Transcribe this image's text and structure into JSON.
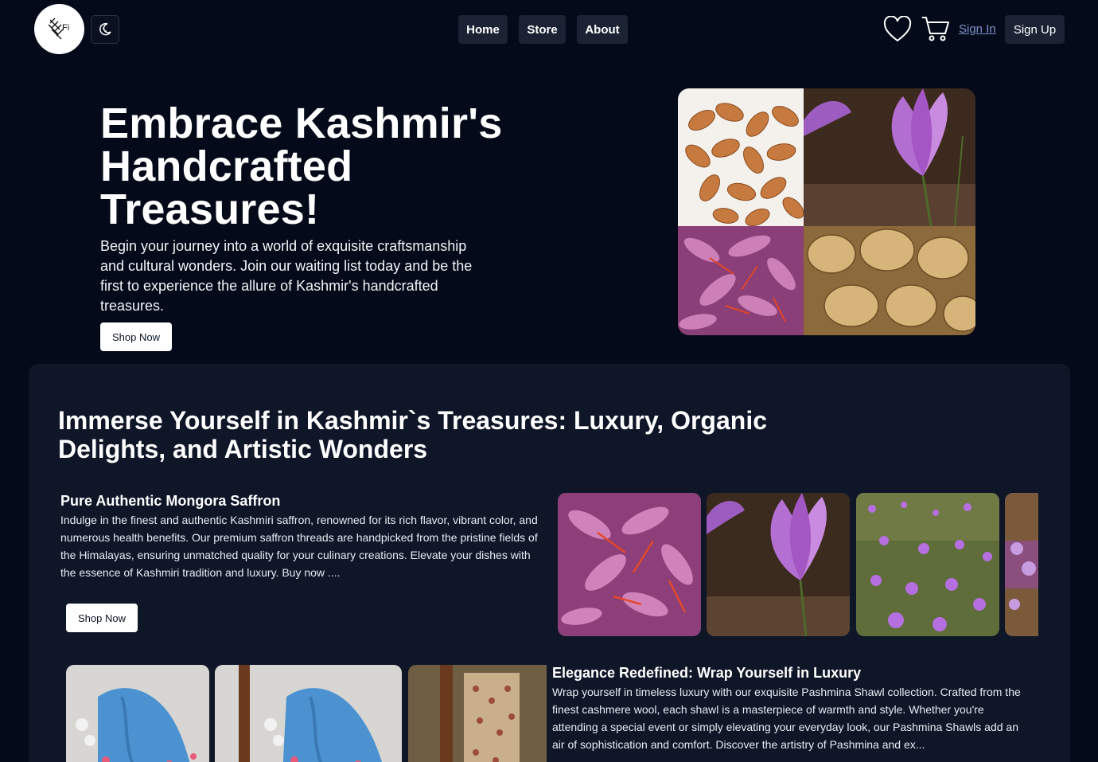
{
  "header": {
    "logo_text": "Fi",
    "nav": [
      "Home",
      "Store",
      "About"
    ],
    "signin": "Sign In",
    "signup": "Sign Up"
  },
  "hero": {
    "title": "Embrace Kashmir's Handcrafted Treasures!",
    "description": "Begin your journey into a world of exquisite craftsmanship and cultural wonders. Join our waiting list today and be the first to experience the allure of Kashmir's handcrafted treasures.",
    "cta": "Shop Now"
  },
  "section": {
    "title": "Immerse Yourself in Kashmir`s Treasures: Luxury, Organic Delights, and Artistic Wonders",
    "products": [
      {
        "title": "Pure Authentic Mongora Saffron",
        "description": "Indulge in the finest and authentic Kashmiri saffron, renowned for its rich flavor, vibrant color, and numerous health benefits. Our premium saffron threads are handpicked from the pristine fields of the Himalayas, ensuring unmatched quality for your culinary creations. Elevate your dishes with the essence of Kashmiri tradition and luxury. Buy now ....",
        "cta": "Shop Now"
      },
      {
        "title": "Elegance Redefined: Wrap Yourself in Luxury",
        "description": "Wrap yourself in timeless luxury with our exquisite Pashmina Shawl collection. Crafted from the finest cashmere wool, each shawl is a masterpiece of warmth and style. Whether you're attending a special event or simply elevating your everyday look, our Pashmina Shawls add an air of sophistication and comfort. Discover the artistry of Pashmina and ex..."
      }
    ]
  },
  "icons": {
    "logo": "kashmir-logo-icon",
    "theme": "moon-icon",
    "wishlist": "heart-icon",
    "cart": "cart-icon"
  }
}
